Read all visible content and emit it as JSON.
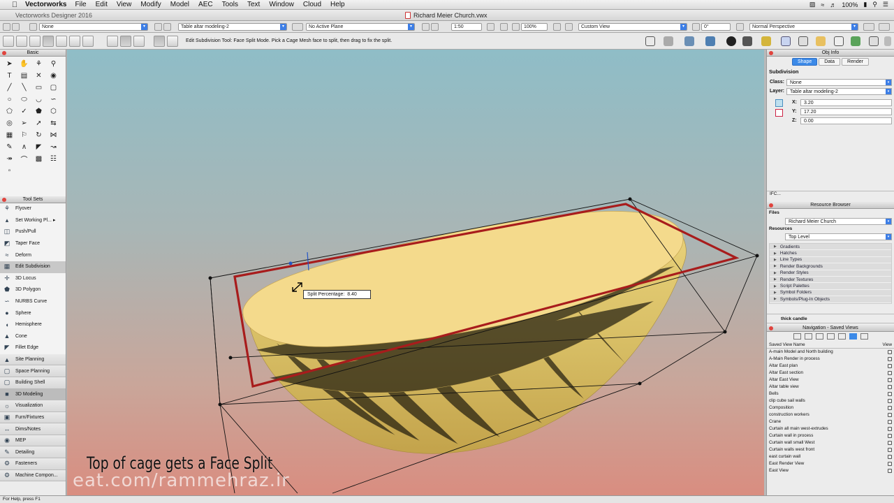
{
  "menubar": {
    "app_name": "Vectorworks",
    "items": [
      "File",
      "Edit",
      "View",
      "Modify",
      "Model",
      "AEC",
      "Tools",
      "Text",
      "Window",
      "Cloud",
      "Help"
    ],
    "battery": "100%",
    "status_icons": [
      "dropbox-icon",
      "wifi-icon",
      "volume-icon",
      "battery-icon",
      "search-icon",
      "list-icon"
    ]
  },
  "titlebar": {
    "app_title": "Vectorworks Designer 2016",
    "doc_title": "Richard Meier Church.vwx"
  },
  "viewbar": {
    "class_value": "None",
    "layer_value": "Table altar modeling-2",
    "plane_value": "No Active Plane",
    "scale_value": "1:50",
    "zoom_value": "100%",
    "view_value": "Custom View",
    "rotation_value": "0°",
    "projection_value": "Normal Perspective"
  },
  "modebar": {
    "hint": "Edit Subdivision Tool: Face Split Mode. Pick a Cage Mesh face to split, then drag to fix the split."
  },
  "left": {
    "basic_title": "Basic",
    "toolsets_title": "Tool Sets",
    "tools": [
      {
        "label": "Flyover",
        "icon": "flyover-icon",
        "selected": false,
        "cat": false
      },
      {
        "label": "Set Working Pl... ▸",
        "icon": "working-plane-icon",
        "selected": false,
        "cat": false
      },
      {
        "label": "Push/Pull",
        "icon": "push-pull-icon",
        "selected": false,
        "cat": false
      },
      {
        "label": "Taper Face",
        "icon": "taper-face-icon",
        "selected": false,
        "cat": false
      },
      {
        "label": "Deform",
        "icon": "deform-icon",
        "selected": false,
        "cat": false
      },
      {
        "label": "Edit Subdivision",
        "icon": "edit-subdivision-icon",
        "selected": true,
        "cat": false
      },
      {
        "label": "3D Locus",
        "icon": "locus-icon",
        "selected": false,
        "cat": false
      },
      {
        "label": "3D Polygon",
        "icon": "polygon-3d-icon",
        "selected": false,
        "cat": false
      },
      {
        "label": "NURBS Curve",
        "icon": "nurbs-icon",
        "selected": false,
        "cat": false
      },
      {
        "label": "Sphere",
        "icon": "sphere-icon",
        "selected": false,
        "cat": false
      },
      {
        "label": "Hemisphere",
        "icon": "hemisphere-icon",
        "selected": false,
        "cat": false
      },
      {
        "label": "Cone",
        "icon": "cone-icon",
        "selected": false,
        "cat": false
      },
      {
        "label": "Fillet Edge",
        "icon": "fillet-icon",
        "selected": false,
        "cat": false
      },
      {
        "label": "Site Planning",
        "icon": "site-planning-icon",
        "selected": false,
        "cat": true
      },
      {
        "label": "Space Planning",
        "icon": "space-planning-icon",
        "selected": false,
        "cat": true
      },
      {
        "label": "Building Shell",
        "icon": "building-shell-icon",
        "selected": false,
        "cat": true
      },
      {
        "label": "3D Modeling",
        "icon": "modeling-icon",
        "selected": true,
        "cat": true
      },
      {
        "label": "Visualization",
        "icon": "visualization-icon",
        "selected": false,
        "cat": true
      },
      {
        "label": "Furn/Fixtures",
        "icon": "furniture-icon",
        "selected": false,
        "cat": true
      },
      {
        "label": "Dims/Notes",
        "icon": "dims-icon",
        "selected": false,
        "cat": true
      },
      {
        "label": "MEP",
        "icon": "mep-icon",
        "selected": false,
        "cat": true
      },
      {
        "label": "Detailing",
        "icon": "detailing-icon",
        "selected": false,
        "cat": true
      },
      {
        "label": "Fasteners",
        "icon": "fasteners-icon",
        "selected": false,
        "cat": true
      },
      {
        "label": "Machine Compon...",
        "icon": "machine-icon",
        "selected": false,
        "cat": true
      }
    ]
  },
  "viewport": {
    "tooltip_label": "Split Percentage:",
    "tooltip_value": "8.40",
    "caption": "Top of cage gets a Face Split",
    "watermark": "eat.com/rammehraz.ir"
  },
  "objinfo": {
    "title": "Obj Info",
    "tabs": [
      "Shape",
      "Data",
      "Render"
    ],
    "active_tab": "Shape",
    "object_type": "Subdivision",
    "class_label": "Class:",
    "class_value": "None",
    "layer_label": "Layer:",
    "layer_value": "Table altar modeling-2",
    "x_label": "X:",
    "x_value": "3.20",
    "y_label": "Y:",
    "y_value": "17.20",
    "z_label": "Z:",
    "z_value": "0.00",
    "ifc": "IFC..."
  },
  "resources": {
    "title": "Resource Browser",
    "files_label": "Files",
    "files_value": "Richard Meier Church",
    "resources_label": "Resources",
    "resources_value": "Top Level",
    "items": [
      "Gradients",
      "Hatches",
      "Line Types",
      "Render Backgrounds",
      "Render Styles",
      "Render Textures",
      "Script Palettes",
      "Symbol Folders",
      "Symbols/Plug-In Objects"
    ],
    "preview_label": "thick candle"
  },
  "navigation": {
    "title": "Navigation - Saved Views",
    "col_name": "Saved View Name",
    "col_view": "View",
    "views": [
      "A-main Model and North building",
      "A-Main Render in process",
      "Altar East plan",
      "Altar East section",
      "Altar East View",
      "Altar table view",
      "Bells",
      "clip cube sail walls",
      "Composition",
      "construction workers",
      "Crane",
      "Curtain all main west-extrudes",
      "Curtain wall in process",
      "Curtain wall small West",
      "Curtain walls west front",
      "east curtain wall",
      "East Render View",
      "East View"
    ]
  },
  "statusbar": {
    "text": "For Help, press F1"
  }
}
